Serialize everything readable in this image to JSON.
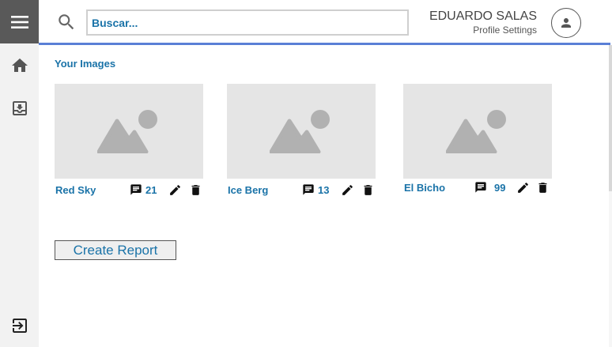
{
  "search": {
    "placeholder": "Buscar..."
  },
  "user": {
    "name": "EDUARDO SALAS",
    "profile_link": "Profile Settings"
  },
  "main": {
    "section_title": "Your Images",
    "images": [
      {
        "name": "Red Sky",
        "comments": "21"
      },
      {
        "name": "Ice Berg",
        "comments": "13"
      },
      {
        "name": "El Bicho",
        "comments": "99"
      }
    ],
    "create_report_label": "Create Report"
  },
  "icons": {
    "menu": "menu-icon",
    "home": "home-icon",
    "inbox": "inbox-icon",
    "logout": "logout-icon",
    "search": "search-icon",
    "avatar": "person-icon",
    "image": "image-placeholder-icon",
    "comment": "comment-icon",
    "edit": "pencil-icon",
    "delete": "trash-icon"
  },
  "colors": {
    "accent": "#1a73a8",
    "topline": "#5a7fd6",
    "menu_bg": "#595959",
    "sidebar_bg": "#f2f2f2"
  }
}
